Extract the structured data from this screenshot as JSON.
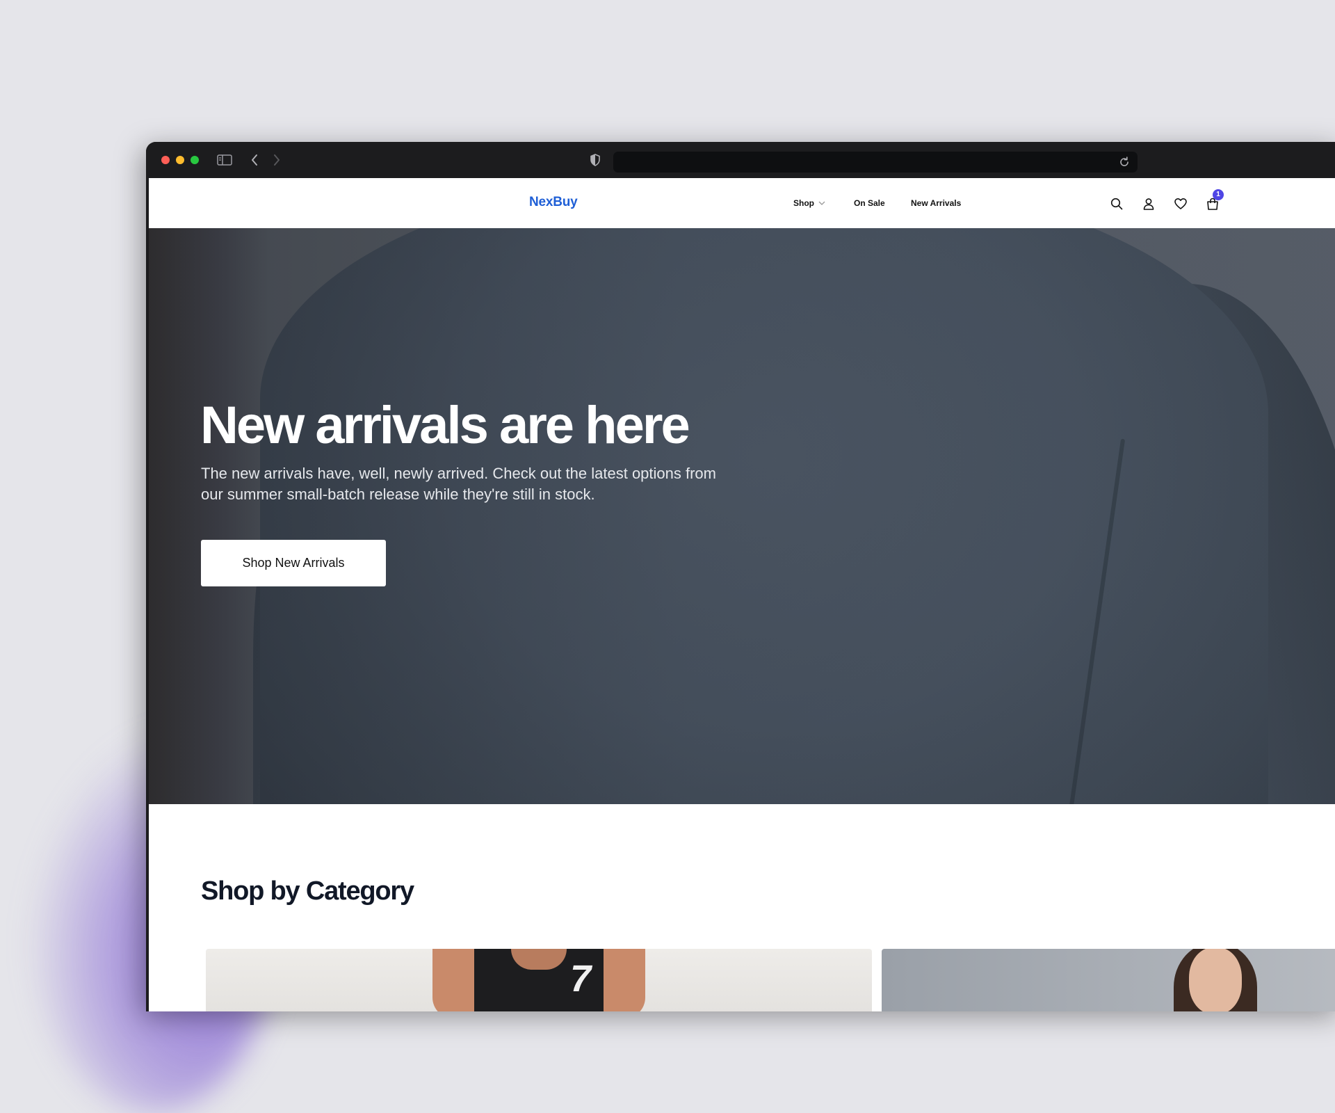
{
  "browser": {
    "address_value": "",
    "icons": [
      "sidebar-toggle-icon",
      "back-arrow-icon",
      "forward-arrow-icon",
      "shield-icon",
      "reload-icon"
    ]
  },
  "nav": {
    "logo": "NexBuy",
    "links": [
      {
        "label": "Shop",
        "has_dropdown": true
      },
      {
        "label": "On Sale"
      },
      {
        "label": "New Arrivals"
      }
    ],
    "icons": [
      "search-icon",
      "user-icon",
      "heart-icon",
      "cart-icon"
    ],
    "cart_count": "1",
    "brand_color": "#1f5fd6",
    "badge_color": "#4f46e5"
  },
  "hero": {
    "title": "New arrivals are here",
    "subtitle": "The new arrivals have, well, newly arrived. Check out the latest options from our summer small-batch release while they're still in stock.",
    "cta": "Shop New Arrivals"
  },
  "categories": {
    "title": "Shop by Category",
    "cards": [
      {
        "image": "basketball-player-photo",
        "jersey_number": "7"
      },
      {
        "image": "woman-portrait-photo"
      }
    ]
  }
}
